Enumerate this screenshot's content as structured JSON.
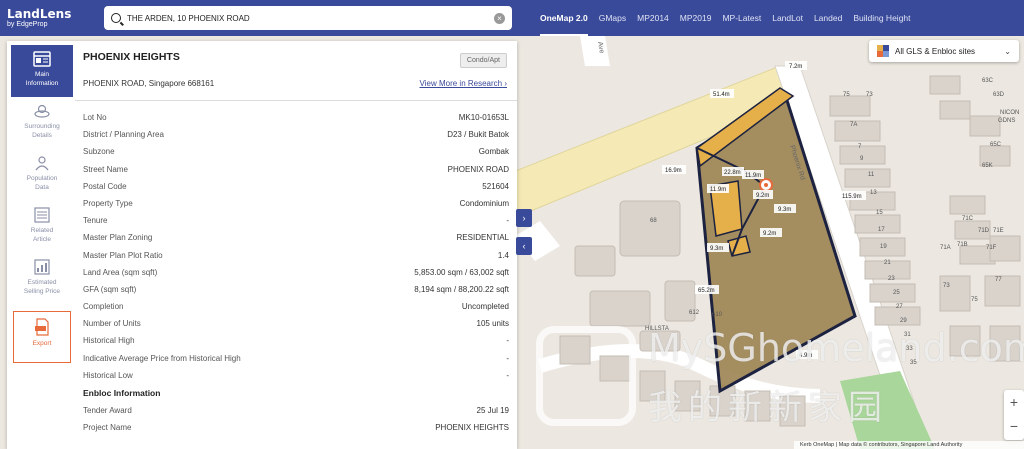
{
  "brand": {
    "name": "LandLens",
    "sub": "by EdgeProp"
  },
  "search": {
    "value": "THE ARDEN, 10 PHOENIX ROAD"
  },
  "map_tabs": [
    "OneMap 2.0",
    "GMaps",
    "MP2014",
    "MP2019",
    "MP-Latest",
    "LandLot",
    "Landed",
    "Building Height"
  ],
  "layer_select": {
    "label": "All GLS & Enbloc sites"
  },
  "nav": [
    {
      "label1": "Main",
      "label2": "Information"
    },
    {
      "label1": "Surrounding",
      "label2": "Details"
    },
    {
      "label1": "Population",
      "label2": "Data"
    },
    {
      "label1": "Related",
      "label2": "Article"
    },
    {
      "label1": "Estimated",
      "label2": "Selling Price"
    },
    {
      "label1": "Export",
      "label2": ""
    }
  ],
  "property": {
    "title": "PHOENIX HEIGHTS",
    "tag": "Condo/Apt",
    "address": "PHOENIX ROAD, Singapore 668161",
    "research_link": "View More in Research"
  },
  "details": [
    {
      "label": "Lot No",
      "value": "MK10-01653L"
    },
    {
      "label": "District / Planning Area",
      "value": "D23 / Bukit Batok"
    },
    {
      "label": "Subzone",
      "value": "Gombak"
    },
    {
      "label": "Street Name",
      "value": "PHOENIX ROAD"
    },
    {
      "label": "Postal Code",
      "value": "521604"
    },
    {
      "label": "Property Type",
      "value": "Condominium"
    },
    {
      "label": "Tenure",
      "value": "-"
    },
    {
      "label": "Master Plan Zoning",
      "value": "RESIDENTIAL"
    },
    {
      "label": "Master Plan Plot Ratio",
      "value": "1.4"
    },
    {
      "label": "Land Area (sqm sqft)",
      "value": "5,853.00 sqm / 63,002 sqft"
    },
    {
      "label": "GFA (sqm sqft)",
      "value": "8,194 sqm / 88,200.22 sqft"
    },
    {
      "label": "Completion",
      "value": "Uncompleted"
    },
    {
      "label": "Number of Units",
      "value": "105 units"
    },
    {
      "label": "Historical High",
      "value": "-"
    },
    {
      "label": "Indicative Average Price from Historical High",
      "value": "-"
    },
    {
      "label": "Historical Low",
      "value": "-"
    }
  ],
  "enbloc": {
    "heading": "Enbloc Information",
    "rows": [
      {
        "label": "Tender Award",
        "value": "25 Jul 19"
      },
      {
        "label": "Project Name",
        "value": "PHOENIX HEIGHTS"
      }
    ]
  },
  "map_labels": {
    "street": "Phoenix Rd",
    "ave": "Ave",
    "hillsta": "HILLSTA",
    "nicon1": "NICON",
    "nicon2": "GDNS",
    "dims": [
      "51.4m",
      "7.2m",
      "22.8m",
      "11.9m",
      "11.9m",
      "9.2m",
      "9.3m",
      "9.2m",
      "9.3m",
      "16.9m",
      "115.9m",
      "65.2m",
      "4.9m"
    ],
    "lots": [
      "75",
      "73",
      "7A",
      "7",
      "9",
      "11",
      "13",
      "15",
      "17",
      "19",
      "21",
      "23",
      "25",
      "27",
      "29",
      "31",
      "33",
      "35",
      "68",
      "612",
      "610",
      "63C",
      "63D",
      "65C",
      "65K",
      "71C",
      "71D",
      "71E",
      "71A",
      "71F",
      "71B",
      "73",
      "75",
      "77"
    ]
  },
  "watermark": {
    "text": "MySGhomeland.com",
    "cn": "我的新新家园"
  },
  "attribution": "Kerb   OneMap | Map data © contributors, Singapore Land Authority",
  "colors": {
    "brand": "#3a4a9a",
    "accent": "#e66a3a",
    "plot": "#9c8452"
  }
}
